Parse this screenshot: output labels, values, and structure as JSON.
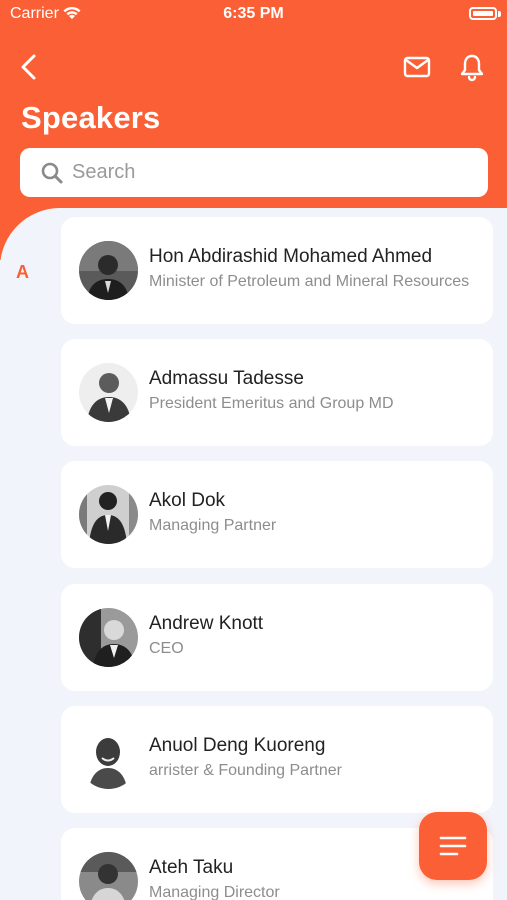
{
  "status_bar": {
    "carrier": "Carrier",
    "time": "6:35 PM"
  },
  "header": {
    "title": "Speakers",
    "back_icon": "chevron-left-icon",
    "mail_icon": "mail-icon",
    "bell_icon": "bell-icon"
  },
  "search": {
    "placeholder": "Search",
    "value": ""
  },
  "section": {
    "letter": "A"
  },
  "speakers": [
    {
      "name": "Hon Abdirashid  Mohamed Ahmed",
      "role": "Minister of Petroleum and Mineral Resources"
    },
    {
      "name": "Admassu  Tadesse",
      "role": "President Emeritus and Group MD"
    },
    {
      "name": "Akol  Dok",
      "role": "Managing Partner"
    },
    {
      "name": "Andrew  Knott",
      "role": "CEO"
    },
    {
      "name": "Anuol  Deng Kuoreng",
      "role": "arrister & Founding Partner"
    },
    {
      "name": "Ateh  Taku",
      "role": "Managing Director"
    }
  ],
  "fab": {
    "icon": "menu-lines-icon"
  },
  "colors": {
    "accent": "#fb5f35",
    "background": "#f2f4fb",
    "card": "#ffffff"
  }
}
